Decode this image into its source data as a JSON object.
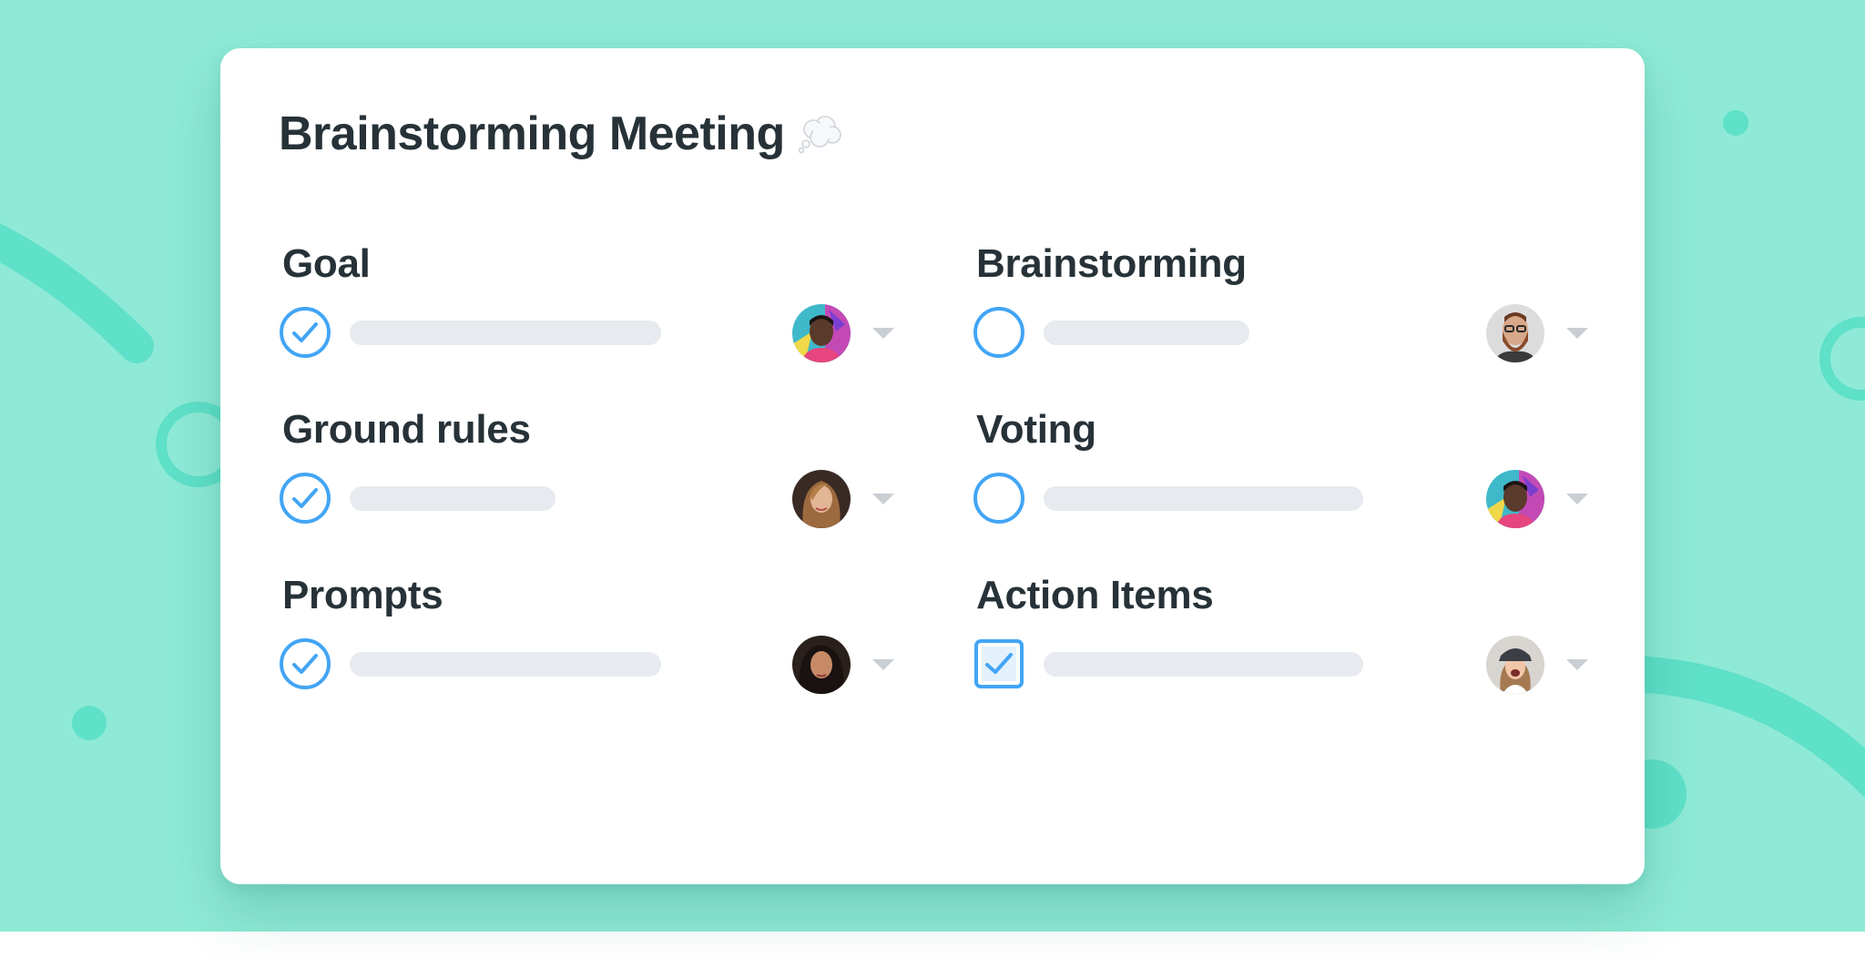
{
  "card": {
    "title": "Brainstorming Meeting"
  },
  "sections": [
    {
      "title": "Goal",
      "status": "done",
      "assignee_icon": "avatar-man-dark-skin",
      "progress": 0.74
    },
    {
      "title": "Brainstorming",
      "status": "open",
      "assignee_icon": "avatar-bearded-man",
      "progress": 0.49
    },
    {
      "title": "Ground rules",
      "status": "done",
      "assignee_icon": "avatar-woman-long-hair",
      "progress": 0.49
    },
    {
      "title": "Voting",
      "status": "open",
      "assignee_icon": "avatar-man-dark-skin",
      "progress": 0.76
    },
    {
      "title": "Prompts",
      "status": "done",
      "assignee_icon": "avatar-woman-curly-hair",
      "progress": 0.74
    },
    {
      "title": "Action Items",
      "status": "checkbox-checked",
      "assignee_icon": "avatar-woman-cap",
      "progress": 0.76
    }
  ],
  "icons": {
    "title_emoji": "thought-bubble-icon",
    "dropdown": "caret-down-icon"
  },
  "colors": {
    "background": "#8eead6",
    "accent_shape": "#5fe0c8",
    "status_blue": "#42a5f5",
    "text": "#263238",
    "bar": "#e7eaee",
    "caret": "#c9ced3"
  }
}
